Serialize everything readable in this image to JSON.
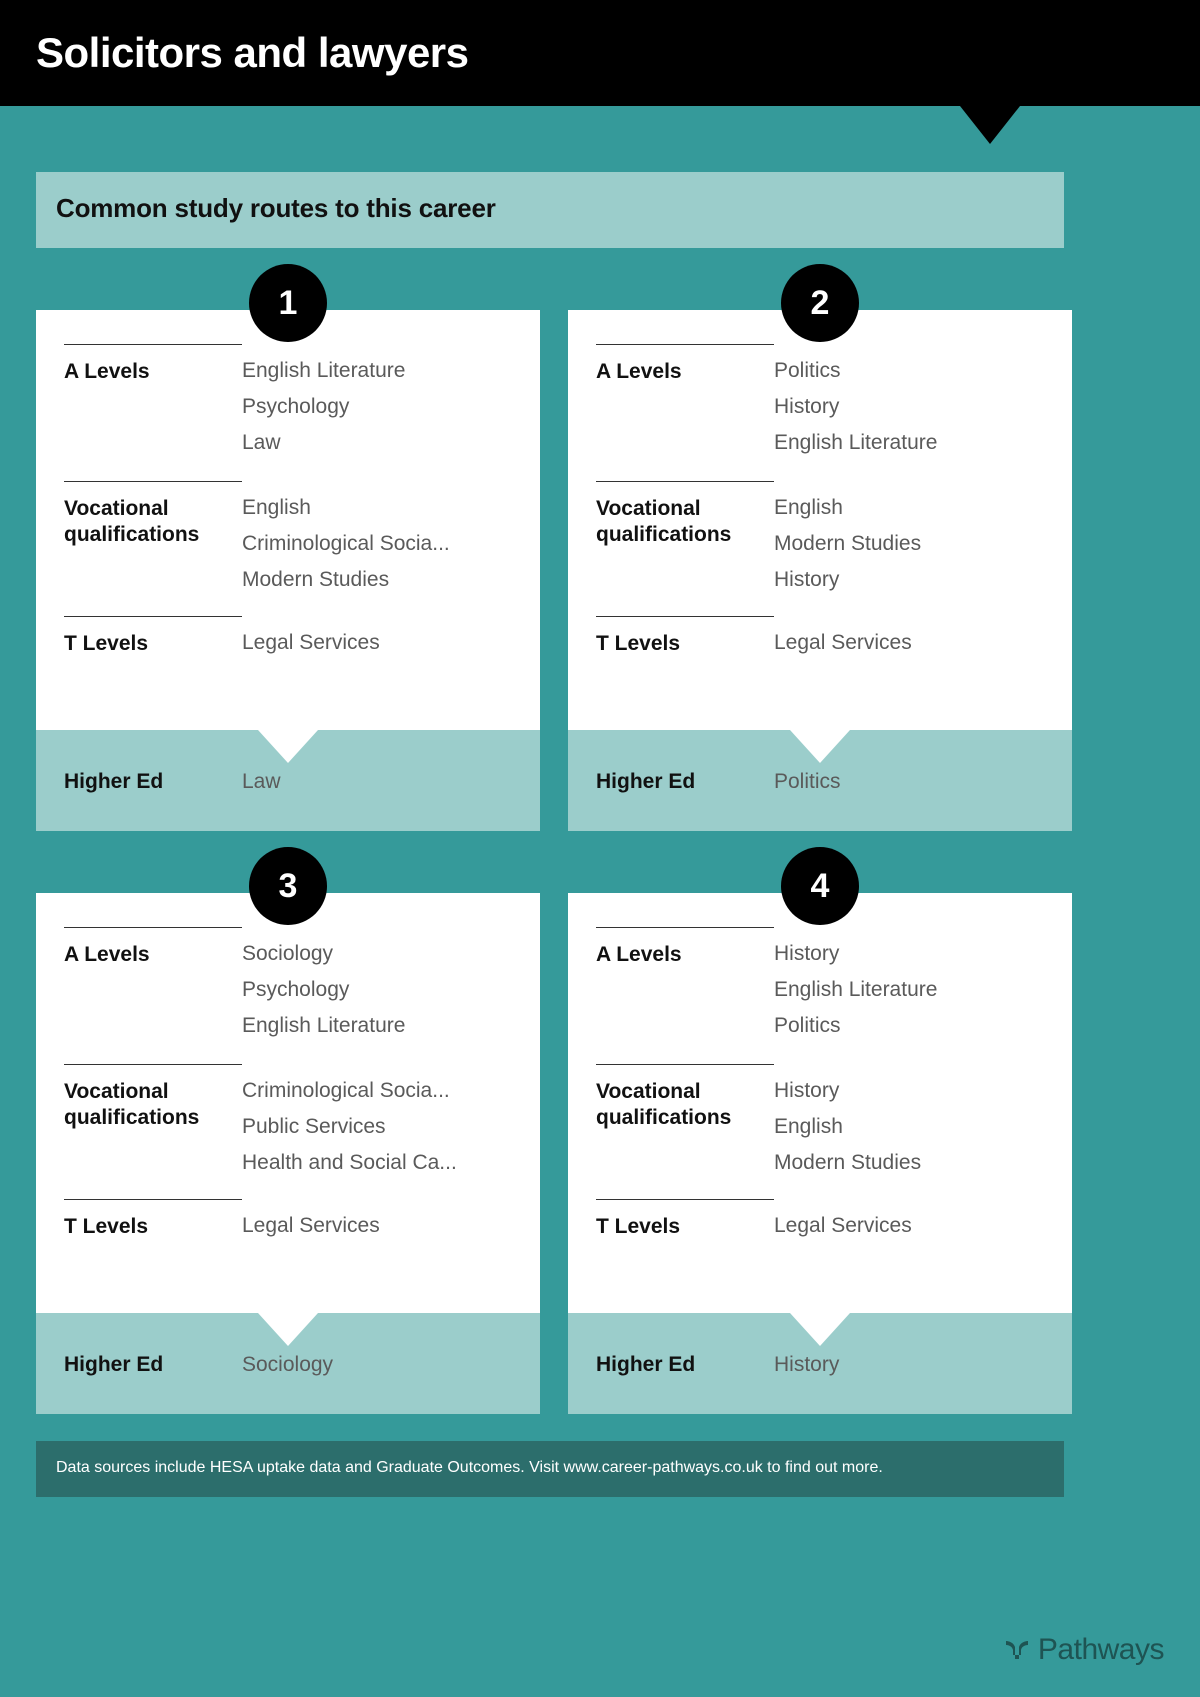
{
  "header": {
    "title": "Solicitors and lawyers",
    "background_color": "#000000"
  },
  "theme": {
    "teal": "#359a9a",
    "light_teal": "#9bcdcb",
    "dark_teal": "#2c6e6c",
    "card_white": "#ffffff",
    "badge_black": "#000000"
  },
  "banner": {
    "text": "Common study routes to this career"
  },
  "labels": {
    "a_levels": "A Levels",
    "vocational": "Vocational qualifications",
    "t_levels": "T Levels",
    "higher_ed": "Higher Ed"
  },
  "routes": [
    {
      "number": "1",
      "a_levels": [
        "English Literature",
        "Psychology",
        "Law"
      ],
      "vocational": [
        "English",
        "Criminological Socia...",
        "Modern Studies"
      ],
      "t_levels": [
        "Legal Services"
      ],
      "higher_ed": "Law"
    },
    {
      "number": "2",
      "a_levels": [
        "Politics",
        "History",
        "English Literature"
      ],
      "vocational": [
        "English",
        "Modern Studies",
        "History"
      ],
      "t_levels": [
        "Legal Services"
      ],
      "higher_ed": "Politics"
    },
    {
      "number": "3",
      "a_levels": [
        "Sociology",
        "Psychology",
        "English Literature"
      ],
      "vocational": [
        "Criminological Socia...",
        "Public Services",
        "Health and Social Ca..."
      ],
      "t_levels": [
        "Legal Services"
      ],
      "higher_ed": "Sociology"
    },
    {
      "number": "4",
      "a_levels": [
        "History",
        "English Literature",
        "Politics"
      ],
      "vocational": [
        "History",
        "English",
        "Modern Studies"
      ],
      "t_levels": [
        "Legal Services"
      ],
      "higher_ed": "History"
    }
  ],
  "footer": {
    "note": "Data sources include HESA uptake data and Graduate Outcomes. Visit www.career-pathways.co.uk to find out more.",
    "logo_text": "Pathways"
  }
}
